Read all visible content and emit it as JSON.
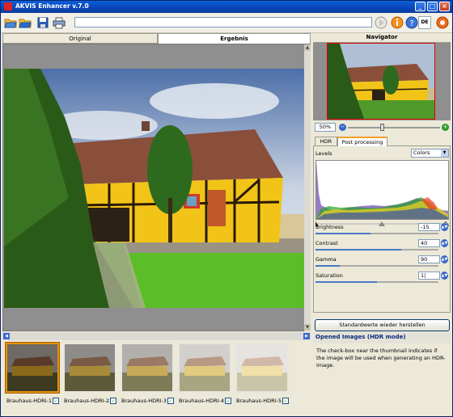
{
  "window": {
    "title": "AKVIS Enhancer v.7.0",
    "minimize_glyph": "_",
    "maximize_glyph": "□",
    "close_glyph": "×"
  },
  "toolbar": {
    "icons": [
      "open-folder-icon",
      "open-folder-hdr-icon",
      "save-icon",
      "print-icon"
    ],
    "right_icons": [
      "run-icon",
      "info-icon",
      "help-icon",
      "akvis-logo-icon"
    ],
    "language": "DE"
  },
  "view_tabs": [
    {
      "label": "Original",
      "active": false
    },
    {
      "label": "Ergebnis",
      "active": true
    }
  ],
  "navigator": {
    "title": "Navigator",
    "zoom": "50%",
    "zoom_out": "−",
    "zoom_in": "+"
  },
  "panel_tabs": [
    {
      "label": "HDR",
      "active": false
    },
    {
      "label": "Post processing",
      "active": true
    }
  ],
  "post_processing": {
    "levels_label": "Levels",
    "channel": "Colors",
    "params": [
      {
        "label": "Brightness",
        "value": "-15",
        "level": 0.45
      },
      {
        "label": "Contrast",
        "value": "40",
        "level": 0.7
      },
      {
        "label": "Gamma",
        "value": "90",
        "level": 0.2
      },
      {
        "label": "Saturation",
        "value": "1|",
        "level": 0.5
      }
    ]
  },
  "reset_button": "Standardwerte wieder herstellen",
  "info": {
    "title": "Opened Images (HDR mode)",
    "text": "The check-box near the thumbnail indicates if the image will be used when generating an HDR-image."
  },
  "thumbnails": [
    {
      "name": "Brauhaus-HDRI-1",
      "checked": "✓",
      "active": true
    },
    {
      "name": "Brauhaus-HDRI-2",
      "checked": "✓",
      "active": false
    },
    {
      "name": "Brauhaus-HDRI-3",
      "checked": "✓",
      "active": false
    },
    {
      "name": "Brauhaus-HDRI-4",
      "checked": "✓",
      "active": false
    },
    {
      "name": "Brauhaus-HDRI-5",
      "checked": "✓",
      "active": false
    }
  ]
}
